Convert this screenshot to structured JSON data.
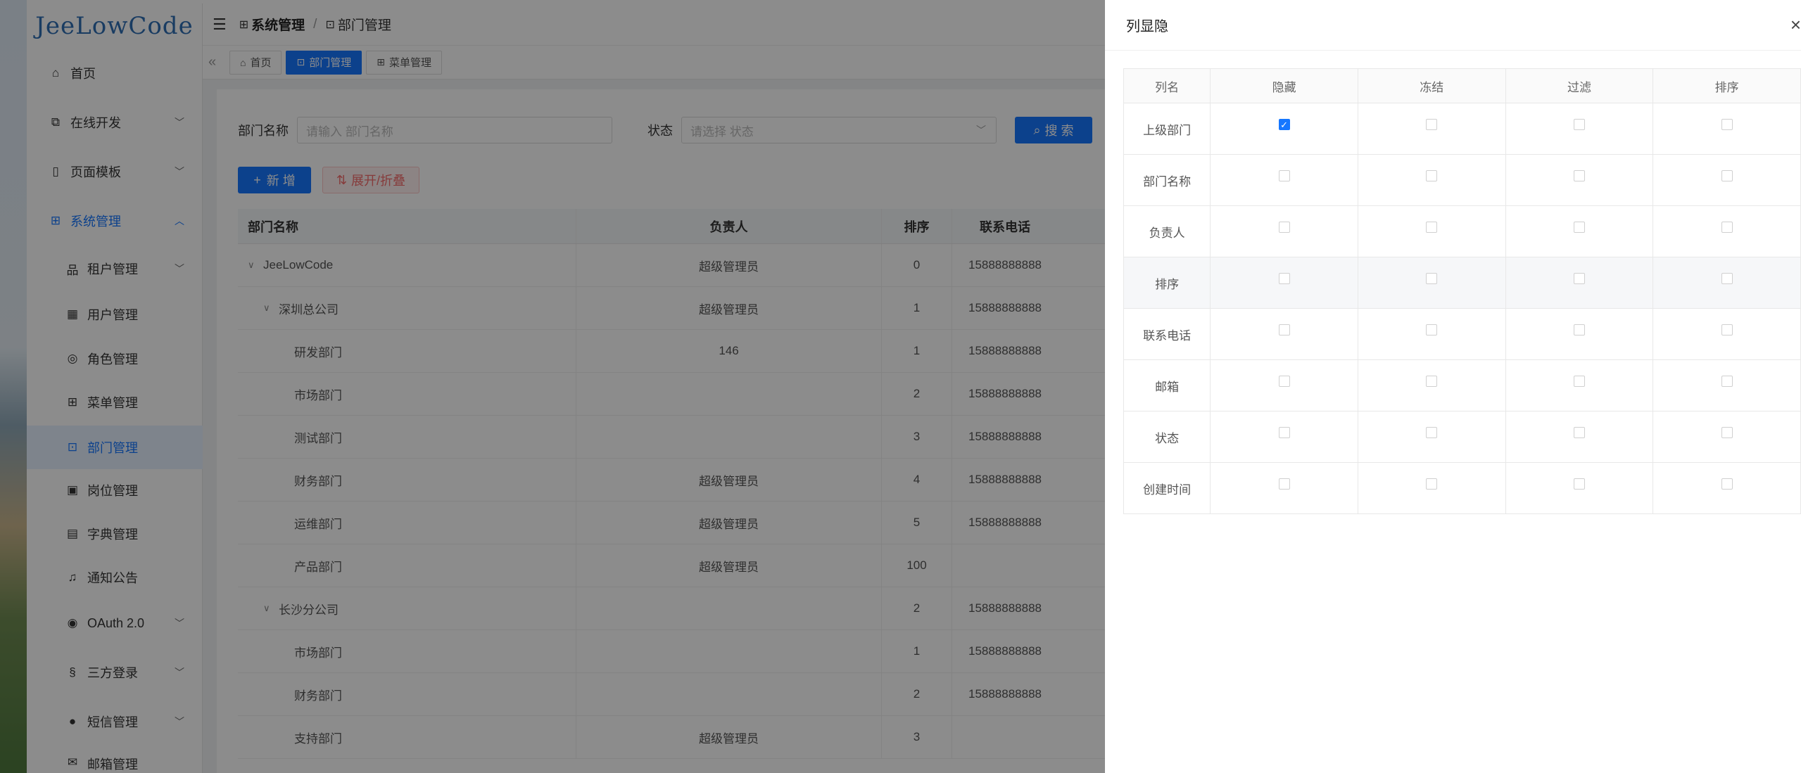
{
  "sidebar": {
    "logo": "JeeLowCode",
    "items": [
      {
        "label": "首页",
        "icon": "home-icon"
      },
      {
        "label": "在线开发",
        "icon": "code-icon"
      },
      {
        "label": "页面模板",
        "icon": "template-icon"
      },
      {
        "label": "系统管理",
        "icon": "grid-icon"
      },
      {
        "label": "租户管理",
        "icon": "tenant-icon"
      },
      {
        "label": "用户管理",
        "icon": "user-icon"
      },
      {
        "label": "角色管理",
        "icon": "role-icon"
      },
      {
        "label": "菜单管理",
        "icon": "menu-grid-icon"
      },
      {
        "label": "部门管理",
        "icon": "department-icon"
      },
      {
        "label": "岗位管理",
        "icon": "post-icon"
      },
      {
        "label": "字典管理",
        "icon": "dictionary-icon"
      },
      {
        "label": "通知公告",
        "icon": "bell-icon"
      },
      {
        "label": "OAuth 2.0",
        "icon": "oauth-icon"
      },
      {
        "label": "三方登录",
        "icon": "third-login-icon"
      },
      {
        "label": "短信管理",
        "icon": "sms-icon"
      },
      {
        "label": "邮箱管理",
        "icon": "mail-icon"
      }
    ]
  },
  "breadcrumb": {
    "parent": "系统管理",
    "current": "部门管理"
  },
  "tabs": [
    {
      "label": "首页"
    },
    {
      "label": "部门管理"
    },
    {
      "label": "菜单管理"
    }
  ],
  "search": {
    "dept_label": "部门名称",
    "dept_placeholder": "请输入 部门名称",
    "status_label": "状态",
    "status_placeholder": "请选择 状态",
    "search_button": "搜 索"
  },
  "actions": {
    "add": "新 增",
    "expand": "展开/折叠"
  },
  "dept_table": {
    "columns": [
      "部门名称",
      "负责人",
      "排序",
      "联系电话"
    ],
    "rows": [
      {
        "name": "JeeLowCode",
        "level": 0,
        "expanded": true,
        "owner": "超级管理员",
        "sort": "0",
        "phone": "15888888888"
      },
      {
        "name": "深圳总公司",
        "level": 1,
        "expanded": true,
        "owner": "超级管理员",
        "sort": "1",
        "phone": "15888888888"
      },
      {
        "name": "研发部门",
        "level": 2,
        "owner": "146",
        "sort": "1",
        "phone": "15888888888"
      },
      {
        "name": "市场部门",
        "level": 2,
        "owner": "",
        "sort": "2",
        "phone": "15888888888"
      },
      {
        "name": "测试部门",
        "level": 2,
        "owner": "",
        "sort": "3",
        "phone": "15888888888"
      },
      {
        "name": "财务部门",
        "level": 2,
        "owner": "超级管理员",
        "sort": "4",
        "phone": "15888888888"
      },
      {
        "name": "运维部门",
        "level": 2,
        "owner": "超级管理员",
        "sort": "5",
        "phone": "15888888888"
      },
      {
        "name": "产品部门",
        "level": 2,
        "owner": "超级管理员",
        "sort": "100",
        "phone": ""
      },
      {
        "name": "长沙分公司",
        "level": 1,
        "expanded": true,
        "owner": "",
        "sort": "2",
        "phone": "15888888888"
      },
      {
        "name": "市场部门",
        "level": 2,
        "owner": "",
        "sort": "1",
        "phone": "15888888888"
      },
      {
        "name": "财务部门",
        "level": 2,
        "owner": "",
        "sort": "2",
        "phone": "15888888888"
      },
      {
        "name": "支持部门",
        "level": 2,
        "owner": "超级管理员",
        "sort": "3",
        "phone": ""
      }
    ]
  },
  "drawer": {
    "title": "列显隐",
    "close_glyph": "×",
    "columns": [
      "列名",
      "隐藏",
      "冻结",
      "过滤",
      "排序"
    ],
    "rows": [
      {
        "name": "上级部门",
        "hidden": true,
        "frozen": false,
        "filter": false,
        "sort": false
      },
      {
        "name": "部门名称",
        "hidden": false,
        "frozen": false,
        "filter": false,
        "sort": false
      },
      {
        "name": "负责人",
        "hidden": false,
        "frozen": false,
        "filter": false,
        "sort": false
      },
      {
        "name": "排序",
        "hidden": false,
        "frozen": false,
        "filter": false,
        "sort": false
      },
      {
        "name": "联系电话",
        "hidden": false,
        "frozen": false,
        "filter": false,
        "sort": false
      },
      {
        "name": "邮箱",
        "hidden": false,
        "frozen": false,
        "filter": false,
        "sort": false
      },
      {
        "name": "状态",
        "hidden": false,
        "frozen": false,
        "filter": false,
        "sort": false
      },
      {
        "name": "创建时间",
        "hidden": false,
        "frozen": false,
        "filter": false,
        "sort": false
      }
    ]
  },
  "colors": {
    "primary": "#1677ff",
    "danger": "#f56c6c",
    "overlay": "rgba(0,0,0,0.45)"
  }
}
